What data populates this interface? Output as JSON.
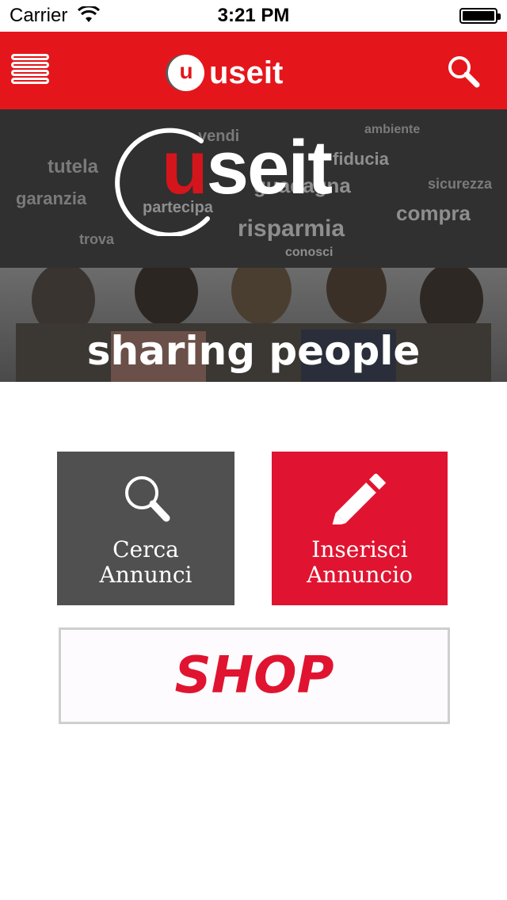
{
  "status_bar": {
    "carrier": "Carrier",
    "time": "3:21 PM"
  },
  "nav": {
    "logo_mark": "u",
    "logo_word": "useit",
    "menu_icon": "hamburger-menu-icon",
    "search_icon": "search-icon"
  },
  "hero": {
    "logo_u": "u",
    "logo_rest": "seit",
    "tagline": "sharing people",
    "cloud_words": [
      "risparmia",
      "garanzia",
      "guadagna",
      "tutela",
      "fiducia",
      "vendi",
      "compra",
      "trova",
      "conosci",
      "sicurezza",
      "partecipa",
      "ambiente"
    ]
  },
  "tiles": {
    "search": {
      "line1": "Cerca",
      "line2": "Annunci"
    },
    "insert": {
      "line1": "Inserisci",
      "line2": "Annuncio"
    }
  },
  "shop": {
    "label": "SHOP"
  },
  "colors": {
    "brand_red": "#e5161b",
    "tile_red": "#e01430",
    "tile_gray": "#505050"
  }
}
